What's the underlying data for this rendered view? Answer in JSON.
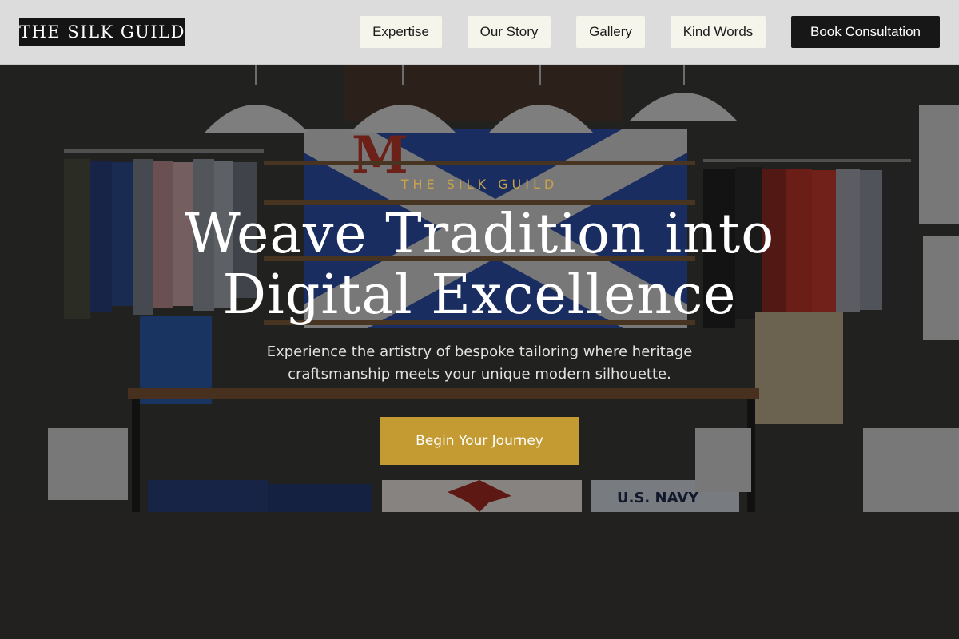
{
  "header": {
    "logo_text": "THE SILK GUILD",
    "nav": [
      {
        "label": "Expertise"
      },
      {
        "label": "Our Story"
      },
      {
        "label": "Gallery"
      },
      {
        "label": "Kind Words"
      }
    ],
    "cta_label": "Book Consultation"
  },
  "hero": {
    "eyebrow": "THE SILK GUILD",
    "headline_line1": "Weave Tradition into",
    "headline_line2": "Digital Excellence",
    "subtext": "Experience the artistry of bespoke tailoring where heritage craftsmanship meets your unique modern silhouette.",
    "button_label": "Begin Your Journey",
    "background_sign_text": "U.S. NAVY"
  },
  "colors": {
    "accent_gold": "#c39b32",
    "header_bg": "#dcdcdc",
    "dark": "#171717"
  },
  "icons": [
    "store-interior-background"
  ]
}
